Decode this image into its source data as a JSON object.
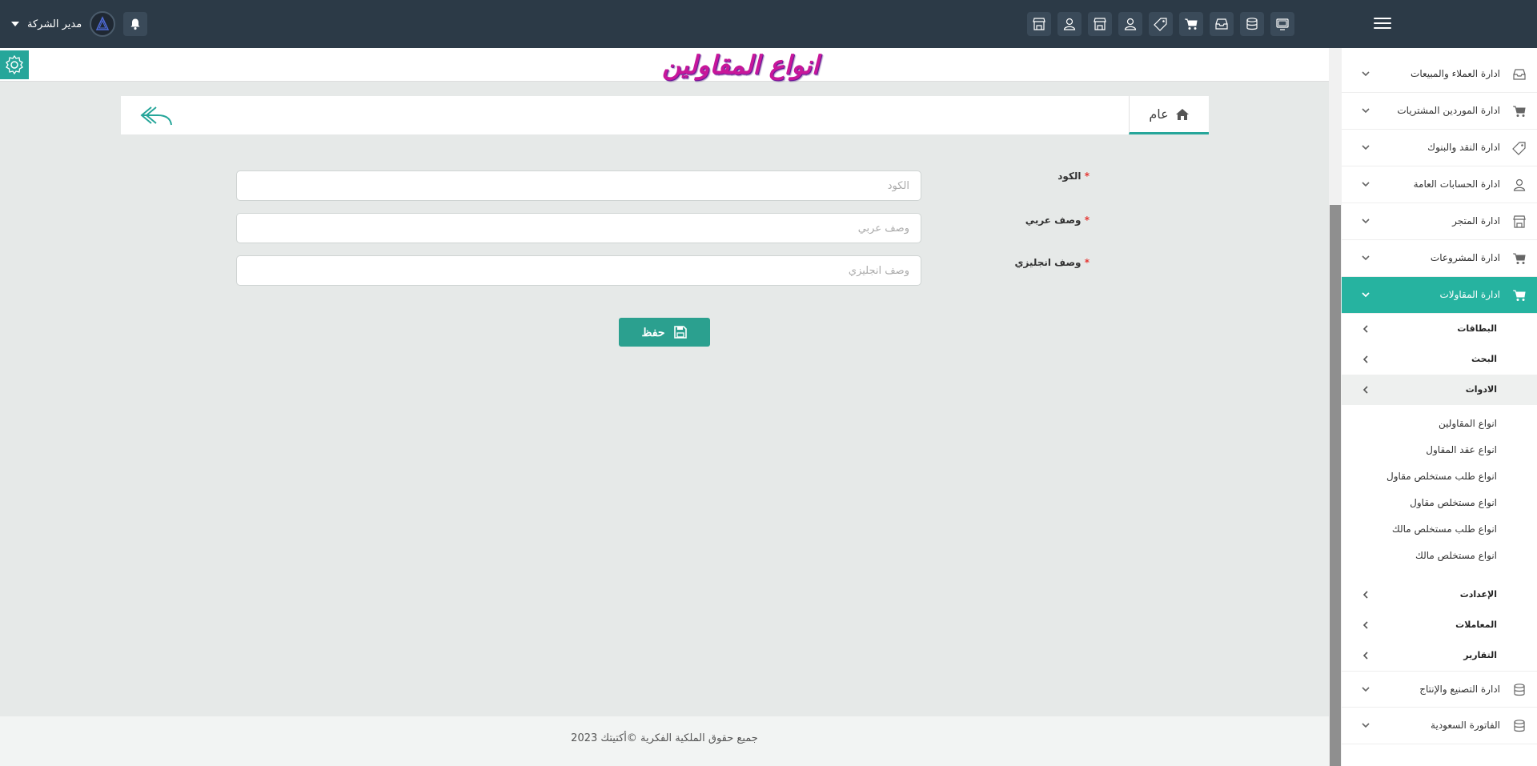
{
  "topbar": {
    "user_name": "مدير الشركة",
    "icons": [
      "monitor-icon",
      "database-icon",
      "inbox-icon",
      "cart-icon",
      "tag-icon",
      "user-icon",
      "store-icon",
      "user-icon",
      "store-icon"
    ]
  },
  "page": {
    "title": "انواع المقاولين"
  },
  "tabs": {
    "general_label": "عام"
  },
  "form": {
    "code": {
      "label": "الكود",
      "placeholder": "الكود",
      "value": ""
    },
    "arabic_desc": {
      "label": "وصف عربي",
      "placeholder": "وصف عربي",
      "value": ""
    },
    "english_desc": {
      "label": "وصف انجليزي",
      "placeholder": "وصف انجليزي",
      "value": ""
    },
    "required_mark": "*",
    "save_label": "حفظ"
  },
  "footer": {
    "copyright": "جميع حقوق الملكية الفكرية ©أكتيتك 2023"
  },
  "sidebar": {
    "top_items": [
      {
        "label": "ادارة العملاء والمبيعات",
        "icon": "inbox-icon"
      },
      {
        "label": "ادارة الموردين المشتريات",
        "icon": "cart-icon"
      },
      {
        "label": "ادارة النقد والبنوك",
        "icon": "tag-icon"
      },
      {
        "label": "ادارة الحسابات العامة",
        "icon": "user-icon"
      },
      {
        "label": "ادارة المتجر",
        "icon": "store-icon"
      },
      {
        "label": "ادارة المشروعات",
        "icon": "cart-icon"
      },
      {
        "label": "ادارة المقاولات",
        "icon": "cart-icon"
      }
    ],
    "sub_items": [
      {
        "label": "البطاقات"
      },
      {
        "label": "البحث"
      },
      {
        "label": "الادوات"
      }
    ],
    "leaf_items": [
      {
        "label": "انواع المقاولين"
      },
      {
        "label": "انواع عقد المقاول"
      },
      {
        "label": "انواع طلب مستخلص مقاول"
      },
      {
        "label": "انواع مستخلص مقاول"
      },
      {
        "label": "انواع طلب مستخلص مالك"
      },
      {
        "label": "انواع مستخلص مالك"
      }
    ],
    "sub_items_after": [
      {
        "label": "الإعدادت"
      },
      {
        "label": "المعاملات"
      },
      {
        "label": "التقارير"
      }
    ],
    "bottom_items": [
      {
        "label": "ادارة التصنيع والإنتاج",
        "icon": "database-icon"
      },
      {
        "label": "الفاتورة السعودية",
        "icon": "database-icon"
      }
    ]
  },
  "colors": {
    "topbar": "#2c3a47",
    "accent": "#26a69a",
    "title": "#c8179a",
    "required": "#e53935"
  }
}
